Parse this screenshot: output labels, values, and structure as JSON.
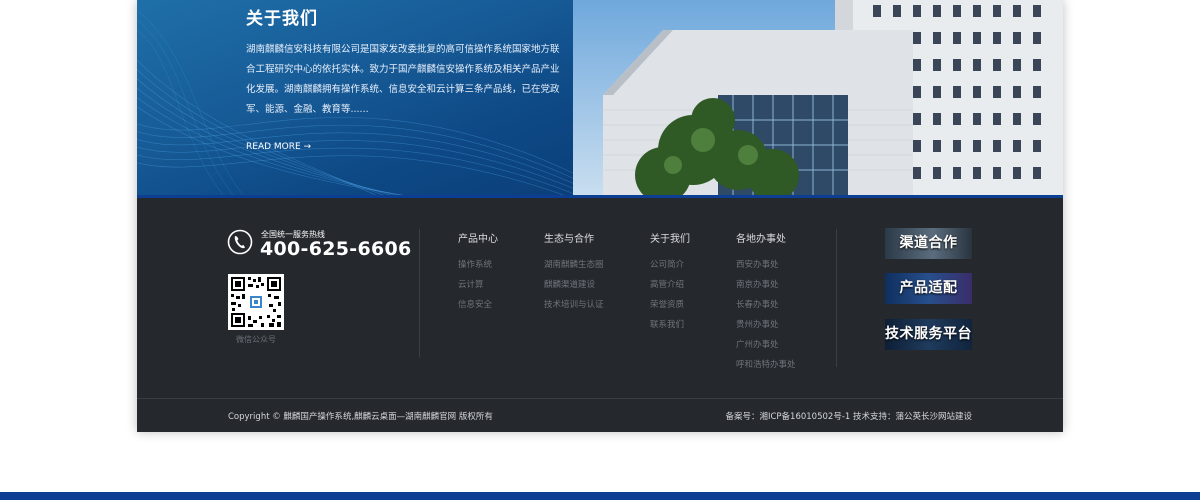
{
  "about": {
    "title": "关于我们",
    "text": "湖南麒麟信安科技有限公司是国家发改委批复的高可信操作系统国家地方联合工程研究中心的依托实体。致力于国产麒麟信安操作系统及相关产品产业化发展。湖南麒麟拥有操作系统、信息安全和云计算三条产品线，已在党政军、能源、金融、教育等......",
    "read_more": "READ MORE →"
  },
  "footer": {
    "hotline_label": "全国统一服务热线",
    "hotline_number": "400-625-6606",
    "qr_caption": "微信公众号",
    "columns": [
      {
        "title": "产品中心",
        "links": [
          "操作系统",
          "云计算",
          "信息安全"
        ]
      },
      {
        "title": "生态与合作",
        "links": [
          "湖南麒麟生态圈",
          "麒麟渠道建设",
          "技术培训与认证"
        ]
      },
      {
        "title": "关于我们",
        "links": [
          "公司简介",
          "高管介绍",
          "荣誉资质",
          "联系我们"
        ]
      },
      {
        "title": "各地办事处",
        "links": [
          "西安办事处",
          "南京办事处",
          "长春办事处",
          "贵州办事处",
          "广州办事处",
          "呼和浩特办事处"
        ]
      }
    ],
    "banners": [
      {
        "label": "渠道合作",
        "color": "#3a4a5a"
      },
      {
        "label": "产品适配",
        "color": "#1e3b6e"
      },
      {
        "label": "技术服务平台",
        "color": "#1a2a40"
      }
    ],
    "copyright": "Copyright © 麒麟国产操作系统,麒麟云桌面—湖南麒麟官网   版权所有",
    "icp": "备案号：湘ICP备16010502号-1     技术支持：蒲公英长沙网站建设"
  },
  "colors": {
    "brand_blue": "#0c3e93",
    "footer_bg": "#25282d"
  }
}
